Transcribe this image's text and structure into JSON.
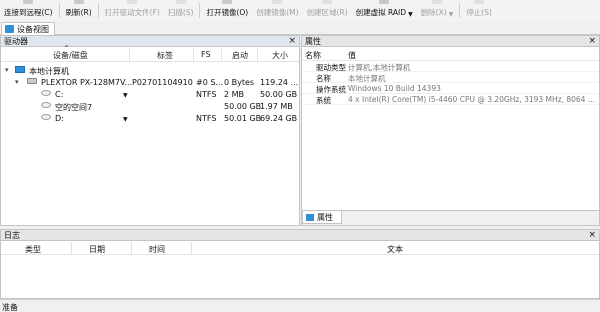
{
  "toolbar": {
    "buttons": [
      {
        "label": "连接到远程(C)",
        "enabled": true
      },
      {
        "label": "刷新(R)",
        "enabled": true
      },
      {
        "label": "打开驱动文件(F)",
        "enabled": false
      },
      {
        "label": "扫描(S)",
        "enabled": false
      },
      {
        "label": "打开镜像(O)",
        "enabled": true
      },
      {
        "label": "创建镜像(M)",
        "enabled": false
      },
      {
        "label": "创建区域(R)",
        "enabled": false
      },
      {
        "label": "创建虚拟 RAID",
        "enabled": true
      },
      {
        "label": "删除(X)",
        "enabled": false
      },
      {
        "label": "停止(S)",
        "enabled": false
      }
    ]
  },
  "doc_tab": {
    "label": "设备视图"
  },
  "drives_panel": {
    "title": "驱动器",
    "close": "×",
    "columns": {
      "device": "设备/磁盘",
      "label": "标签",
      "fs": "FS",
      "start": "启动",
      "size": "大小"
    },
    "rows": [
      {
        "name": "本地计算机",
        "label": "",
        "fs": "",
        "start": "",
        "size": ""
      },
      {
        "name": "PLEXTOR PX-128M7V...",
        "label": "P02701104910",
        "fs": "#0 S...",
        "start": "0 Bytes",
        "size": "119.24 ..."
      },
      {
        "name": "C:",
        "label": "",
        "fs": "NTFS",
        "start": "2 MB",
        "size": "50.00 GB"
      },
      {
        "name": "空的空间7",
        "label": "",
        "fs": "",
        "start": "50.00 GB",
        "size": "1.97 MB"
      },
      {
        "name": "D:",
        "label": "",
        "fs": "NTFS",
        "start": "50.01 GB",
        "size": "69.24 GB"
      }
    ]
  },
  "props_panel": {
    "title": "属性",
    "close": "×",
    "columns": {
      "name": "名称",
      "value": "值"
    },
    "rows": [
      {
        "name": "驱动类型",
        "value": "计算机,本地计算机"
      },
      {
        "name": "名称",
        "value": "本地计算机"
      },
      {
        "name": "操作系统",
        "value": "Windows 10 Build 14393"
      },
      {
        "name": "系统",
        "value": "4 x Intel(R) Core(TM) i5-4460  CPU @ 3.20GHz, 3193 MHz, 8064 ..."
      }
    ],
    "tab_label": "属性"
  },
  "log_panel": {
    "title": "日志",
    "close": "×",
    "columns": {
      "type": "类型",
      "date": "日期",
      "time": "时间",
      "text": "文本"
    }
  },
  "status_bar": {
    "text": "准备"
  },
  "colors": {
    "accent": "#2f8fd8"
  }
}
